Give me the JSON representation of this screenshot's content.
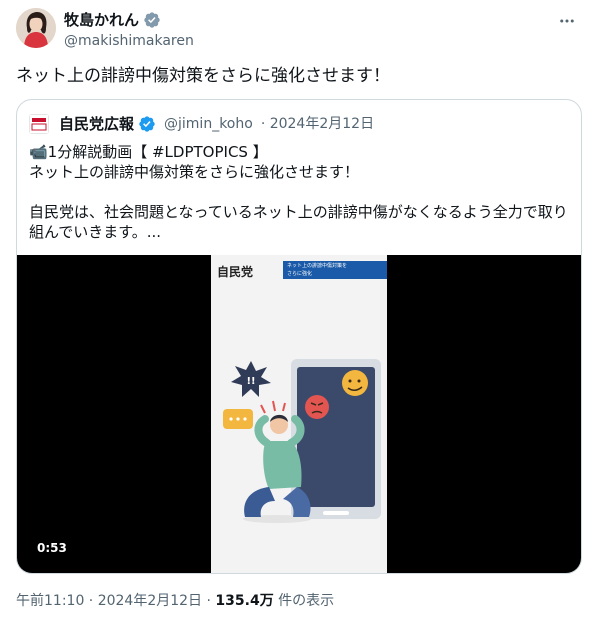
{
  "author": {
    "display_name": "牧島かれん",
    "handle": "@makishimakaren"
  },
  "tweet": {
    "text": "ネット上の誹謗中傷対策をさらに強化させます！"
  },
  "quoted": {
    "display_name": "自民党広報",
    "handle": "@jimin_koho",
    "date": "· 2024年2月12日",
    "line1": "📹1分解説動画【 #LDPTOPICS 】",
    "line2": "ネット上の誹謗中傷対策をさらに強化させます！",
    "line3": "自民党は、社会問題となっているネット上の誹謗中傷がなくなるよう全力で取り組んでいきます。...",
    "video": {
      "brand": "自民党",
      "banner_line1": "ネット上の誹謗中傷対策を",
      "banner_line2": "さらに強化",
      "duration": "0:53"
    }
  },
  "footer": {
    "time_date": "午前11:10 · 2024年2月12日 · ",
    "views": "135.4万",
    "views_label": " 件の表示"
  },
  "colors": {
    "verified": "#1d9bf0",
    "muted": "#536471",
    "border": "#cfd9de"
  },
  "icons": [
    "verified-badge-icon",
    "more-options-icon",
    "party-logo-icon",
    "video-camera-icon"
  ]
}
